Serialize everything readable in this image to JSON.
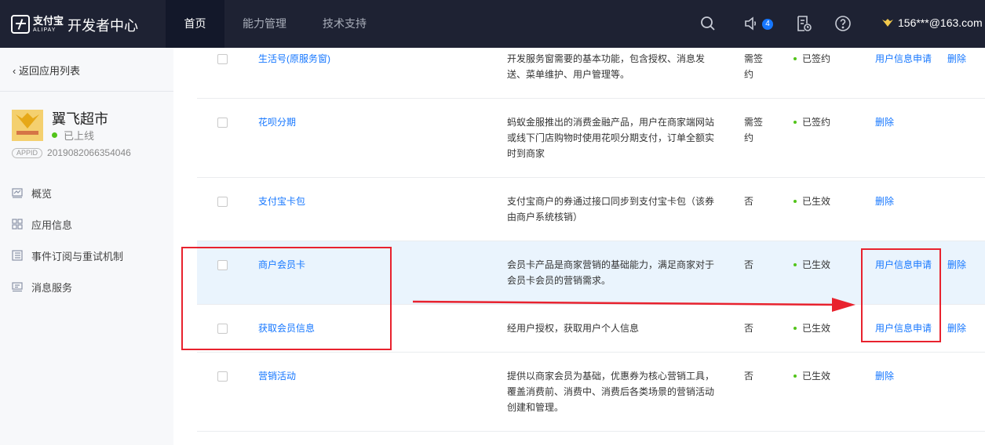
{
  "header": {
    "logo_cn": "支付宝",
    "logo_en": "ALIPAY",
    "title": "开发者中心",
    "tabs": [
      {
        "label": "首页",
        "active": true
      },
      {
        "label": "能力管理",
        "active": false
      },
      {
        "label": "技术支持",
        "active": false
      }
    ],
    "icons": [
      "search-icon",
      "speaker-icon",
      "document-icon",
      "help-icon"
    ],
    "notification_count": "4",
    "user": "156***@163.com"
  },
  "sidebar": {
    "back_label": "返回应用列表",
    "app_name": "翼飞超市",
    "app_status": "已上线",
    "appid_label": "APPID",
    "appid_value": "2019082066354046",
    "menu": [
      {
        "label": "概览",
        "icon": "overview-icon"
      },
      {
        "label": "应用信息",
        "icon": "apps-grid-icon"
      },
      {
        "label": "事件订阅与重试机制",
        "icon": "list-icon"
      },
      {
        "label": "消息服务",
        "icon": "message-icon"
      }
    ]
  },
  "table": {
    "rows": [
      {
        "name": "生活号(原服务窗)",
        "desc": "开发服务窗需要的基本功能，包含授权、消息发送、菜单维护、用户管理等。",
        "sign": "需签约",
        "status": "已签约",
        "op1": "用户信息申请",
        "op2": "删除"
      },
      {
        "name": "花呗分期",
        "desc": "蚂蚁金服推出的消费金融产品，用户在商家端网站或线下门店购物时使用花呗分期支付，订单全额实时到商家",
        "sign": "需签约",
        "status": "已签约",
        "op1": "删除",
        "op2": ""
      },
      {
        "name": "支付宝卡包",
        "desc": "支付宝商户的券通过接口同步到支付宝卡包（该券由商户系统核销）",
        "sign": "否",
        "status": "已生效",
        "op1": "删除",
        "op2": ""
      },
      {
        "name": "商户会员卡",
        "desc": "会员卡产品是商家营销的基础能力，满足商家对于会员卡会员的营销需求。",
        "sign": "否",
        "status": "已生效",
        "op1": "用户信息申请",
        "op2": "删除"
      },
      {
        "name": "获取会员信息",
        "desc": "经用户授权，获取用户个人信息",
        "sign": "否",
        "status": "已生效",
        "op1": "用户信息申请",
        "op2": "删除"
      },
      {
        "name": "营销活动",
        "desc": "提供以商家会员为基础，优惠券为核心营销工具，覆盖消费前、消费中、消费后各类场景的营销活动创建和管理。",
        "sign": "否",
        "status": "已生效",
        "op1": "删除",
        "op2": ""
      }
    ]
  },
  "colors": {
    "topbar": "#1e2233",
    "link": "#1677ff",
    "status_green": "#52c41a",
    "annotation_red": "#e8222e",
    "row_highlight": "#eaf4fd"
  }
}
